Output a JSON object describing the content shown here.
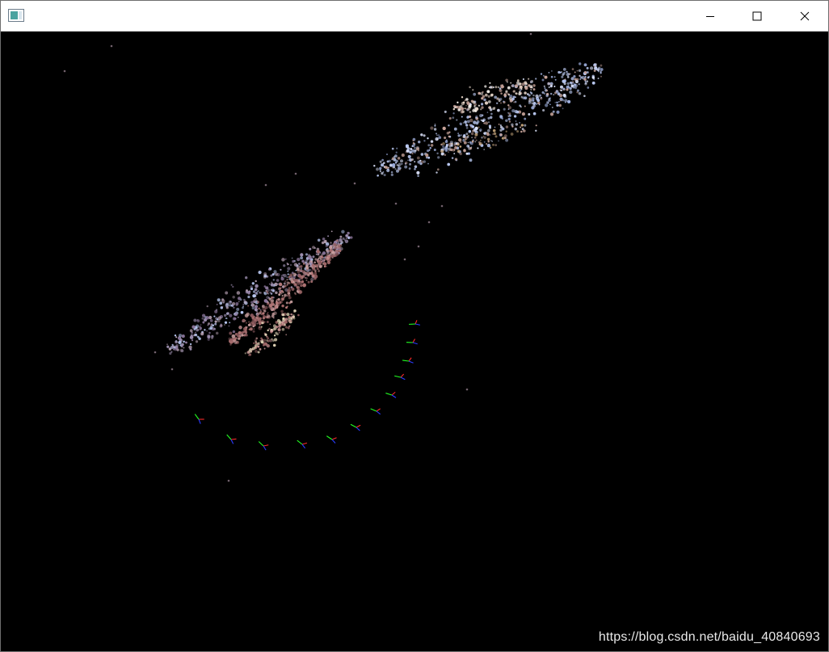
{
  "window": {
    "title": "",
    "controls": {
      "minimize": "minimize",
      "maximize": "maximize",
      "close": "close"
    },
    "app_icon": "window-app-icon"
  },
  "viewer": {
    "background_color": "#000000",
    "content": "3D point cloud with camera pose trajectory",
    "point_colors": {
      "cool": "#b7c6ef",
      "warm": "#c8a49a",
      "red": "#a56b6c"
    },
    "axis_colors": {
      "x": "#ff2a2a",
      "y": "#22ff22",
      "z": "#2a3cff"
    },
    "camera_pose_count": 12
  },
  "watermark": {
    "text": "https://blog.csdn.net/baidu_40840693"
  }
}
